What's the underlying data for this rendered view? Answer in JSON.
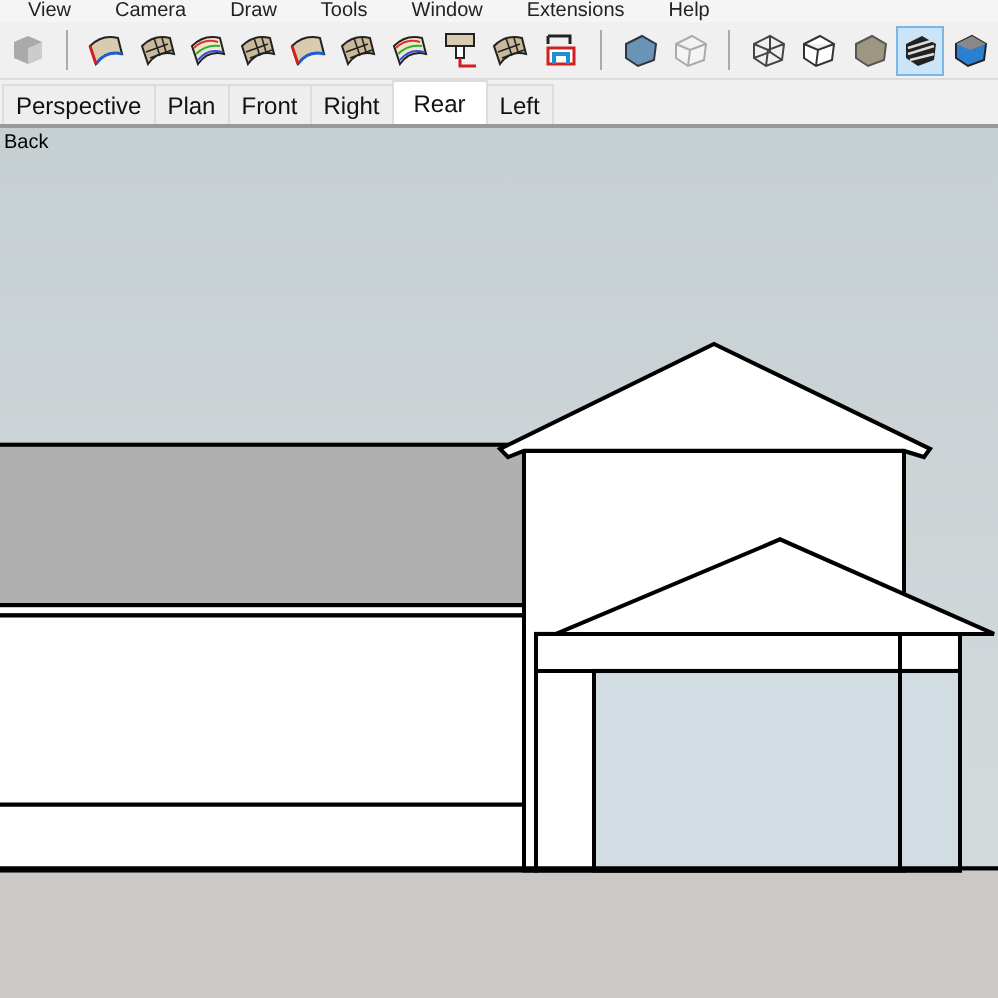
{
  "menu": [
    "View",
    "Camera",
    "Draw",
    "Tools",
    "Window",
    "Extensions",
    "Help"
  ],
  "toolbar": [
    {
      "kind": "component",
      "selected": false
    },
    {
      "kind": "surface",
      "selected": false
    },
    {
      "kind": "surface-grid",
      "selected": false
    },
    {
      "kind": "surface-rainbow",
      "selected": false
    },
    {
      "kind": "surface-grid",
      "selected": false
    },
    {
      "kind": "surface",
      "selected": false
    },
    {
      "kind": "surface-grid",
      "selected": false
    },
    {
      "kind": "surface-rainbow",
      "selected": false
    },
    {
      "kind": "stamp",
      "selected": false
    },
    {
      "kind": "surface-grid",
      "selected": false
    },
    {
      "kind": "section",
      "selected": false
    },
    {
      "kind": "xray-cube",
      "selected": false
    },
    {
      "kind": "back-edges-cube",
      "selected": false
    },
    {
      "kind": "wire-cube",
      "selected": false
    },
    {
      "kind": "hidden-cube",
      "selected": false
    },
    {
      "kind": "shaded-cube",
      "selected": false
    },
    {
      "kind": "textured-cube",
      "selected": true
    },
    {
      "kind": "mono-cube",
      "selected": false
    }
  ],
  "tabs": [
    {
      "label": "Perspective",
      "selected": false
    },
    {
      "label": "Plan",
      "selected": false
    },
    {
      "label": "Front",
      "selected": false
    },
    {
      "label": "Right",
      "selected": false
    },
    {
      "label": "Rear",
      "selected": true
    },
    {
      "label": "Left",
      "selected": false
    }
  ],
  "viewport": {
    "label": "Back"
  }
}
